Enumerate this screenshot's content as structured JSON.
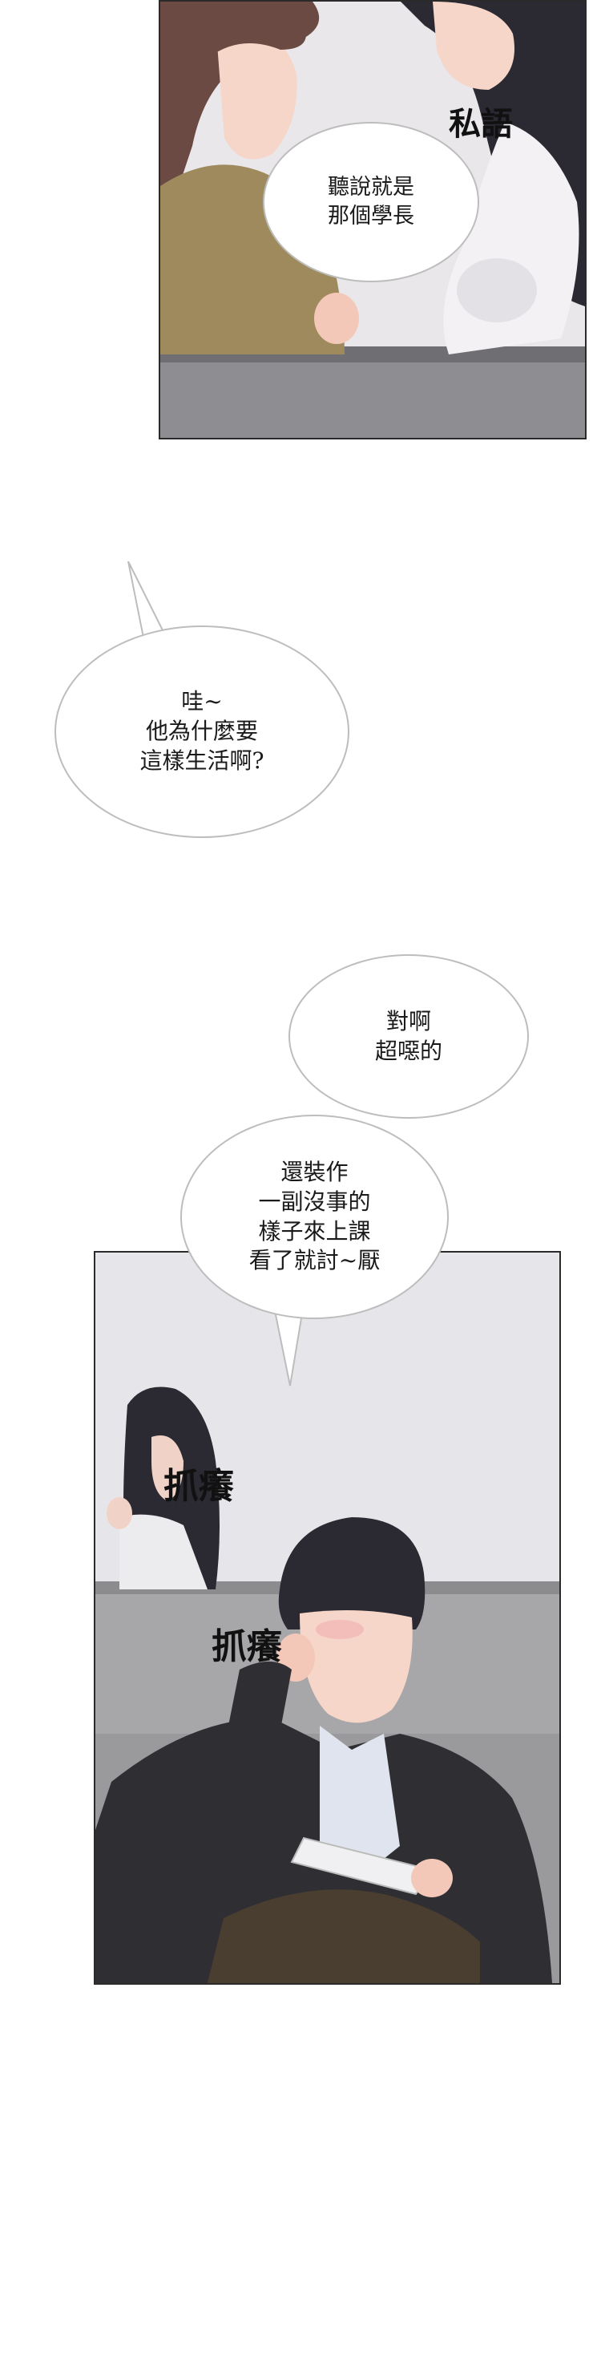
{
  "panels": {
    "top": {
      "dialogue": "聽說就是\n那個學長",
      "sfx": "私語"
    },
    "middle": {
      "dialogue": "哇~\n他為什麼要\n這樣生活啊?"
    },
    "lower": {
      "dialogue_1": "對啊\n超噁的",
      "dialogue_2": "還裝作\n一副沒事的\n樣子來上課\n看了就討~厭"
    },
    "bottom": {
      "sfx_1": "抓癢",
      "sfx_2": "抓癢"
    }
  },
  "colors": {
    "shirt_olive": "#9e8a5c",
    "hair_brown": "#6b4a44",
    "hair_dark": "#2b2a33",
    "skin": "#f6d6c8",
    "jacket": "#2f2f33",
    "wall": "#e6e6ea",
    "floor": "#9a9a9c"
  }
}
